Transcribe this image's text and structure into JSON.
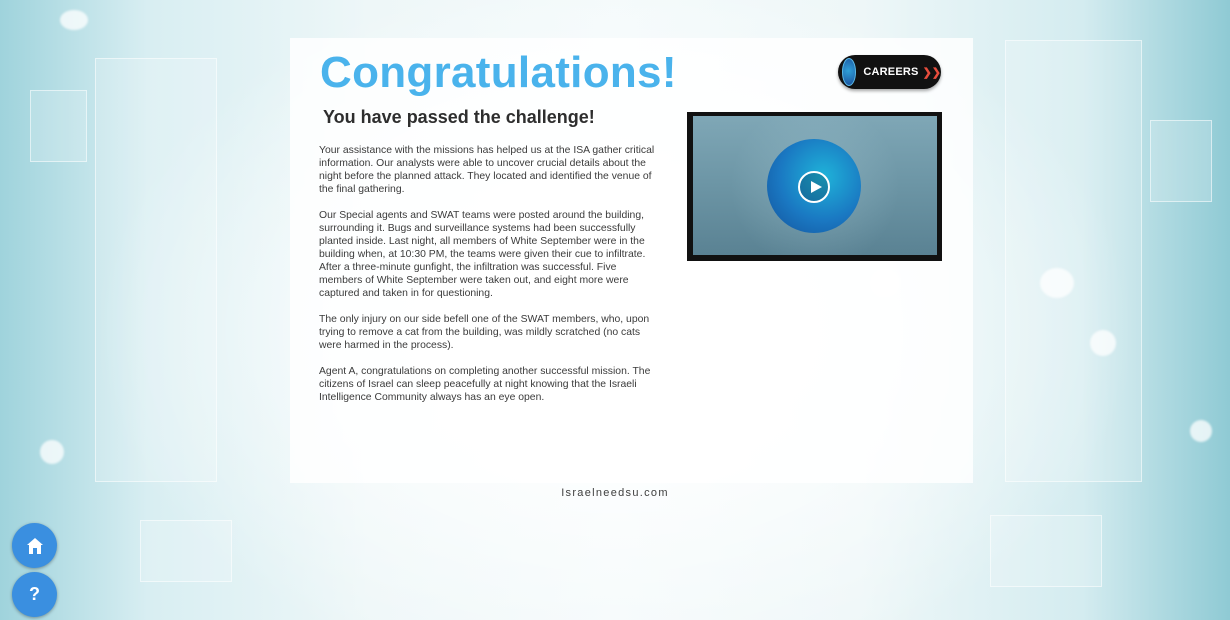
{
  "header": {
    "title": "Congratulations!",
    "subtitle": "You have passed the challenge!",
    "careers_label": "CAREERS",
    "careers_chevron": "❯❯"
  },
  "message": {
    "paragraphs": [
      "Your assistance with the missions has helped us at the ISA gather critical information. Our analysts were able to uncover crucial details about the night before the planned attack. They located and identified the venue of the final gathering.",
      "Our Special agents and SWAT teams were posted around the building, surrounding it. Bugs and surveillance systems had been successfully planted inside. Last night, all members of White September were in the building when, at 10:30 PM, the teams were given their cue to infiltrate. After a three-minute gunfight, the infiltration was successful. Five members of White September were taken out, and eight more were captured and taken in for questioning.",
      "The only injury on our side befell one of the SWAT members, who, upon trying to remove a cat from the building, was mildly scratched (no cats were harmed in the process).",
      "Agent A, congratulations on completing another successful mission. The citizens of Israel can sleep peacefully at night knowing that the Israeli Intelligence Community always has an eye open."
    ]
  },
  "video": {
    "icons": [
      "play-icon",
      "agency-emblem-icon"
    ]
  },
  "footer": {
    "url": "Israelneedsu.com"
  },
  "fabs": {
    "home_icon": "home-icon",
    "help_label": "?"
  },
  "colors": {
    "title": "#4ab3ec",
    "fab": "#3a8fe0",
    "careers_bg": "#111111",
    "careers_chevron": "#e84d3d"
  }
}
